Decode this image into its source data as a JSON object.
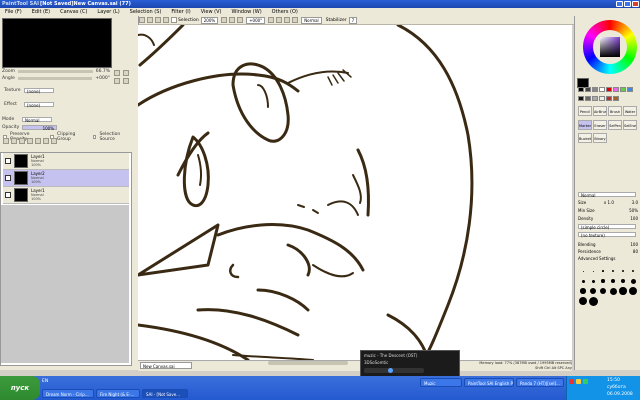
{
  "window": {
    "app_logo": "PaintTool SAI",
    "title": "[Not Saved]New Canvas.sai (77)"
  },
  "menu": [
    "File (F)",
    "Edit (E)",
    "Canvas (C)",
    "Layer (L)",
    "Selection (S)",
    "Filter (I)",
    "View (V)",
    "Window (W)",
    "Others (O)"
  ],
  "toolbar": {
    "selection_label": "Selection",
    "zoom_value": "200%",
    "angle_value": "+000°",
    "normal_label": "Normal",
    "stabilizer_label": "Stabilizer",
    "stabilizer_value": "7"
  },
  "navigator": {
    "zoom_label": "Zoom",
    "zoom_value": "66.7%",
    "angle_label": "Angle",
    "angle_value": "+000°"
  },
  "texture": {
    "texture_label": "Texture",
    "texture_value": "(none)",
    "effect_label": "Effect",
    "effect_value": "(none)"
  },
  "layer_props": {
    "mode_label": "Mode",
    "mode_value": "Normal",
    "opacity_label": "Opacity",
    "opacity_value": "100%",
    "preserve_opacity": "Preserve Opacity",
    "clipping_group": "Clipping Group",
    "selection_source": "Selection Source"
  },
  "layers": [
    {
      "name": "Layer1",
      "mode": "Normal",
      "opacity": "100%",
      "selected": false
    },
    {
      "name": "Layer2",
      "mode": "Normal",
      "opacity": "100%",
      "selected": true
    },
    {
      "name": "Layer1",
      "mode": "Normal",
      "opacity": "100%",
      "selected": false
    }
  ],
  "canvas_tab": "New Canvas.sai",
  "right_panel": {
    "tools": [
      "Pencil",
      "AirBrush",
      "Brush",
      "Water",
      "Marker",
      "Eraser",
      "SelPen",
      "SelEras",
      "Bucket",
      "Binary"
    ],
    "blend_mode": "Normal",
    "size_label": "Size",
    "size_value": "x 1.0",
    "size_num": "3.0",
    "min_size_label": "Min Size",
    "min_size_value": "50%",
    "density_label": "Density",
    "density_value": "100",
    "shape_value": "(simple circle)",
    "texture_value": "(no texture)",
    "blending_label": "Blending",
    "blending_value": "100",
    "persistence_label": "Persistence",
    "persistence_value": "80",
    "advanced_label": "Advanced Settings",
    "brush_sizes": [
      "0.7",
      "0.8",
      "1",
      "1.5",
      "2",
      "2.3",
      "2.6",
      "3",
      "3.5",
      "4",
      "5",
      "6",
      "7",
      "8",
      "9",
      "10",
      "12",
      "14",
      "16",
      "20"
    ]
  },
  "status": {
    "memory": "Memory load: 77% (387MB used / 1995MB reserved)",
    "shift_ctrl": "Shift Ctrl Alt SPC Any"
  },
  "notification": {
    "title": "muzic - The Descent (OST)",
    "subtitle": "3DSoSomtic"
  },
  "taskbar": {
    "start": "пуск",
    "lang": "EN",
    "tasks": [
      {
        "label": "Dream Norm - Cirip...",
        "active": false
      },
      {
        "label": "Fire Night (& E-...",
        "active": false
      },
      {
        "label": "SAI - [Not Save...",
        "active": true
      },
      {
        "label": "Muzic",
        "active": false
      },
      {
        "label": "PaintTool SAI English Pack",
        "active": false
      },
      {
        "label": "Panda 7 (HT)|[sel]...",
        "active": false
      }
    ],
    "time": "15:50",
    "day": "суббота",
    "date": "06.09.2008"
  },
  "colors": {
    "lineart": "#3a2a14",
    "accent": "#c6c2ef"
  }
}
